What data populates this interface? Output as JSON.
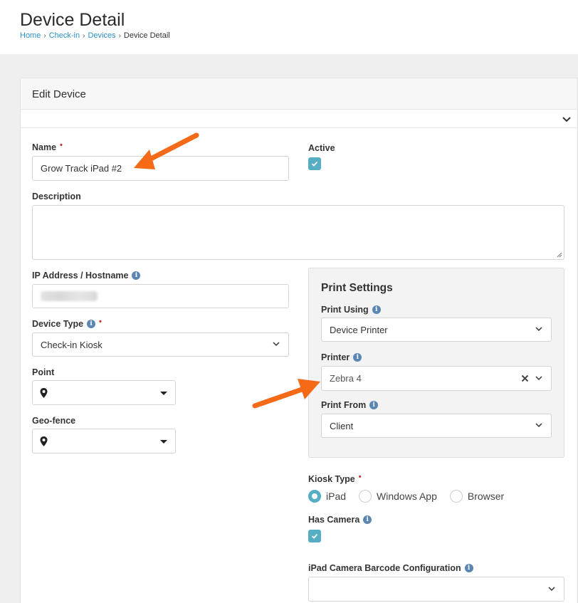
{
  "header": {
    "title": "Device Detail",
    "breadcrumb": [
      "Home",
      "Check-in",
      "Devices"
    ],
    "breadcrumb_current": "Device Detail"
  },
  "card": {
    "title": "Edit Device"
  },
  "form": {
    "name_label": "Name",
    "name_value": "Grow Track iPad #2",
    "active_label": "Active",
    "active_checked": true,
    "description_label": "Description",
    "description_value": "",
    "ip_label": "IP Address / Hostname",
    "device_type_label": "Device Type",
    "device_type_value": "Check-in Kiosk",
    "point_label": "Point",
    "geofence_label": "Geo-fence"
  },
  "print_settings": {
    "title": "Print Settings",
    "print_using_label": "Print Using",
    "print_using_value": "Device Printer",
    "printer_label": "Printer",
    "printer_value": "Zebra 4",
    "print_from_label": "Print From",
    "print_from_value": "Client"
  },
  "kiosk": {
    "kiosk_type_label": "Kiosk Type",
    "options": [
      "iPad",
      "Windows App",
      "Browser"
    ],
    "selected": "iPad",
    "has_camera_label": "Has Camera",
    "has_camera_checked": true,
    "barcode_config_label": "iPad Camera Barcode Configuration",
    "barcode_config_value": ""
  },
  "colors": {
    "accent": "#56aec4",
    "link": "#2a8fc7",
    "annotation_arrow": "#f46a17",
    "required": "#c9302c"
  }
}
